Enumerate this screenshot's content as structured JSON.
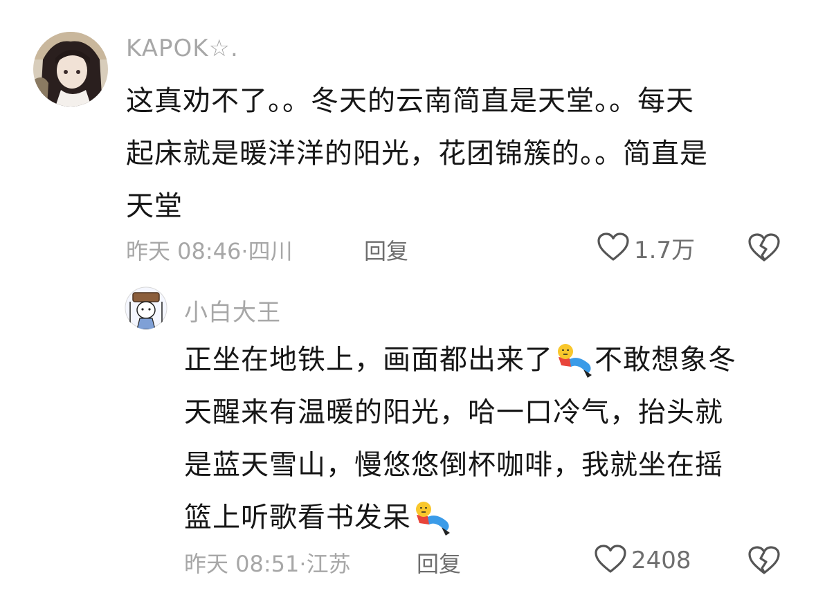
{
  "comments": [
    {
      "username": "KAPOK☆.",
      "text_lines": [
        "这真劝不了。。冬天的云南简直是天堂。。每天",
        "起床就是暖洋洋的阳光，花团锦簇的。。简直是",
        "天堂"
      ],
      "time": "昨天 08:46",
      "location": "四川",
      "reply_label": "回复",
      "likes": "1.7万"
    },
    {
      "username": "小白大王",
      "text_lines": [
        "正坐在地铁上，画面都出来了",
        "不敢想象冬",
        "天醒来有温暖的阳光，哈一口冷气，抬头就",
        "是蓝天雪山，慢悠悠倒杯咖啡，我就坐在摇",
        "篮上听歌看书发呆"
      ],
      "time": "昨天 08:51",
      "location": "江苏",
      "reply_label": "回复",
      "likes": "2408"
    }
  ],
  "icons": {
    "like": "heart-outline-icon",
    "dislike": "broken-heart-icon",
    "emoji": "falling-figure-emoji"
  },
  "colors": {
    "meta_gray": "#a7a7a7",
    "action_gray": "#6e6e6e",
    "text": "#161616"
  }
}
